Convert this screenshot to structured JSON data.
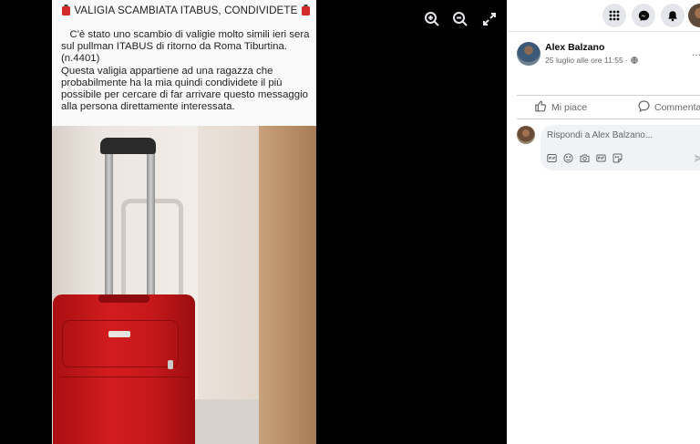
{
  "photo": {
    "title": "VALIGIA SCAMBIATA ITABUS, CONDIVIDETE",
    "body": "C'è stato uno scambio di valigie molto simili ieri sera\nsul pullman ITABUS di ritorno da Roma Tiburtina.\n(n.4401)\nQuesta valigia appartiene ad una ragazza che\nprobabilmente ha la mia quindi condividete il più\npossibile per cercare di far arrivare questo messaggio\nalla persona direttamente interessata.",
    "indent": "   ",
    "brand_label": "",
    "suitcase_color": "#d21c1f"
  },
  "viewer_controls": [
    "zoom-in-icon",
    "zoom-out-icon",
    "fullscreen-icon"
  ],
  "top_bar": {
    "icons": [
      "menu-grid-icon",
      "messenger-icon",
      "notifications-icon",
      "profile-avatar"
    ]
  },
  "post": {
    "author": "Alex Balzano",
    "date": "25 luglio alle ore 11:55",
    "privacy_icon": "globe-icon",
    "more": "..."
  },
  "actions": {
    "like": "Mi piace",
    "comment": "Commenta"
  },
  "comment_box": {
    "placeholder": "Rispondi a Alex Balzano...",
    "tools": [
      "gif-icon",
      "emoji-icon",
      "camera-icon",
      "gif-sticker-icon",
      "sticker-icon"
    ]
  },
  "colors": {
    "viewer_bg": "#000000",
    "panel_bg": "#ffffff",
    "muted_text": "#65676b",
    "input_bg": "#f0f2f5"
  }
}
